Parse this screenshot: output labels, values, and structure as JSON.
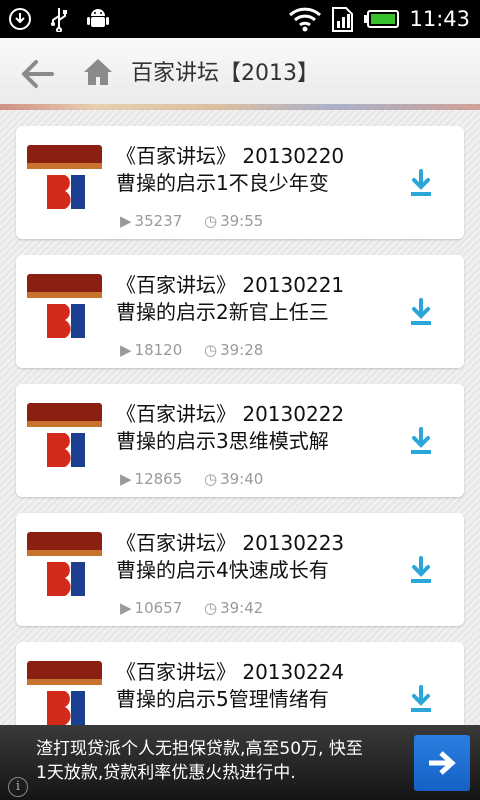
{
  "status_bar": {
    "time": "11:43",
    "icons": [
      "download-notification-icon",
      "usb-icon",
      "android-debug-icon",
      "wifi-icon",
      "sim-signal-icon",
      "battery-icon"
    ]
  },
  "header": {
    "title": "百家讲坛【2013】",
    "back_icon": "back-arrow-icon",
    "home_icon": "home-icon"
  },
  "episodes": [
    {
      "title_line1": "《百家讲坛》 20130220",
      "title_line2": "曹操的启示1不良少年变",
      "play_count": "35237",
      "duration": "39:55"
    },
    {
      "title_line1": "《百家讲坛》 20130221",
      "title_line2": "曹操的启示2新官上任三",
      "play_count": "18120",
      "duration": "39:28"
    },
    {
      "title_line1": "《百家讲坛》 20130222",
      "title_line2": "曹操的启示3思维模式解",
      "play_count": "12865",
      "duration": "39:40"
    },
    {
      "title_line1": "《百家讲坛》 20130223",
      "title_line2": "曹操的启示4快速成长有",
      "play_count": "10657",
      "duration": "39:42"
    },
    {
      "title_line1": "《百家讲坛》 20130224",
      "title_line2": "曹操的启示5管理情绪有",
      "play_count": "",
      "duration": ""
    }
  ],
  "ad": {
    "text_line1": "渣打现贷派个人无担保贷款,高至50万, 快至",
    "text_line2": "1天放款,贷款利率优惠火热进行中.",
    "info_label": "i"
  },
  "colors": {
    "accent_download": "#2aa6d8",
    "ad_button": "#1e6fd3"
  }
}
